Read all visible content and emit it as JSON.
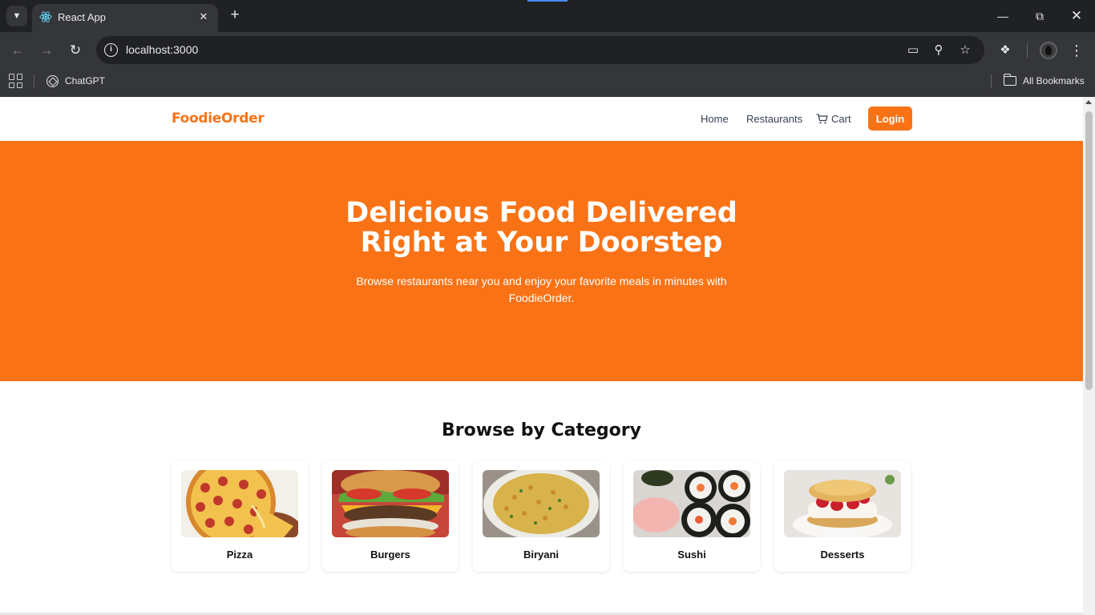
{
  "browser": {
    "tab_title": "React App",
    "url": "localhost:3000",
    "bookmarks": [
      {
        "label": "ChatGPT"
      }
    ],
    "all_bookmarks_label": "All Bookmarks"
  },
  "site": {
    "brand": "FoodieOrder",
    "nav": {
      "home": "Home",
      "restaurants": "Restaurants",
      "cart": "Cart",
      "login": "Login"
    },
    "hero": {
      "title_line1": "Delicious Food Delivered",
      "title_line2": "Right at Your Doorstep",
      "subtitle": "Browse restaurants near you and enjoy your favorite meals in minutes with FoodieOrder."
    },
    "categories_title": "Browse by Category",
    "categories": [
      {
        "label": "Pizza"
      },
      {
        "label": "Burgers"
      },
      {
        "label": "Biryani"
      },
      {
        "label": "Sushi"
      },
      {
        "label": "Desserts"
      }
    ]
  },
  "colors": {
    "accent": "#f97316",
    "chrome_dark": "#202124",
    "chrome_toolbar": "#35363a"
  }
}
